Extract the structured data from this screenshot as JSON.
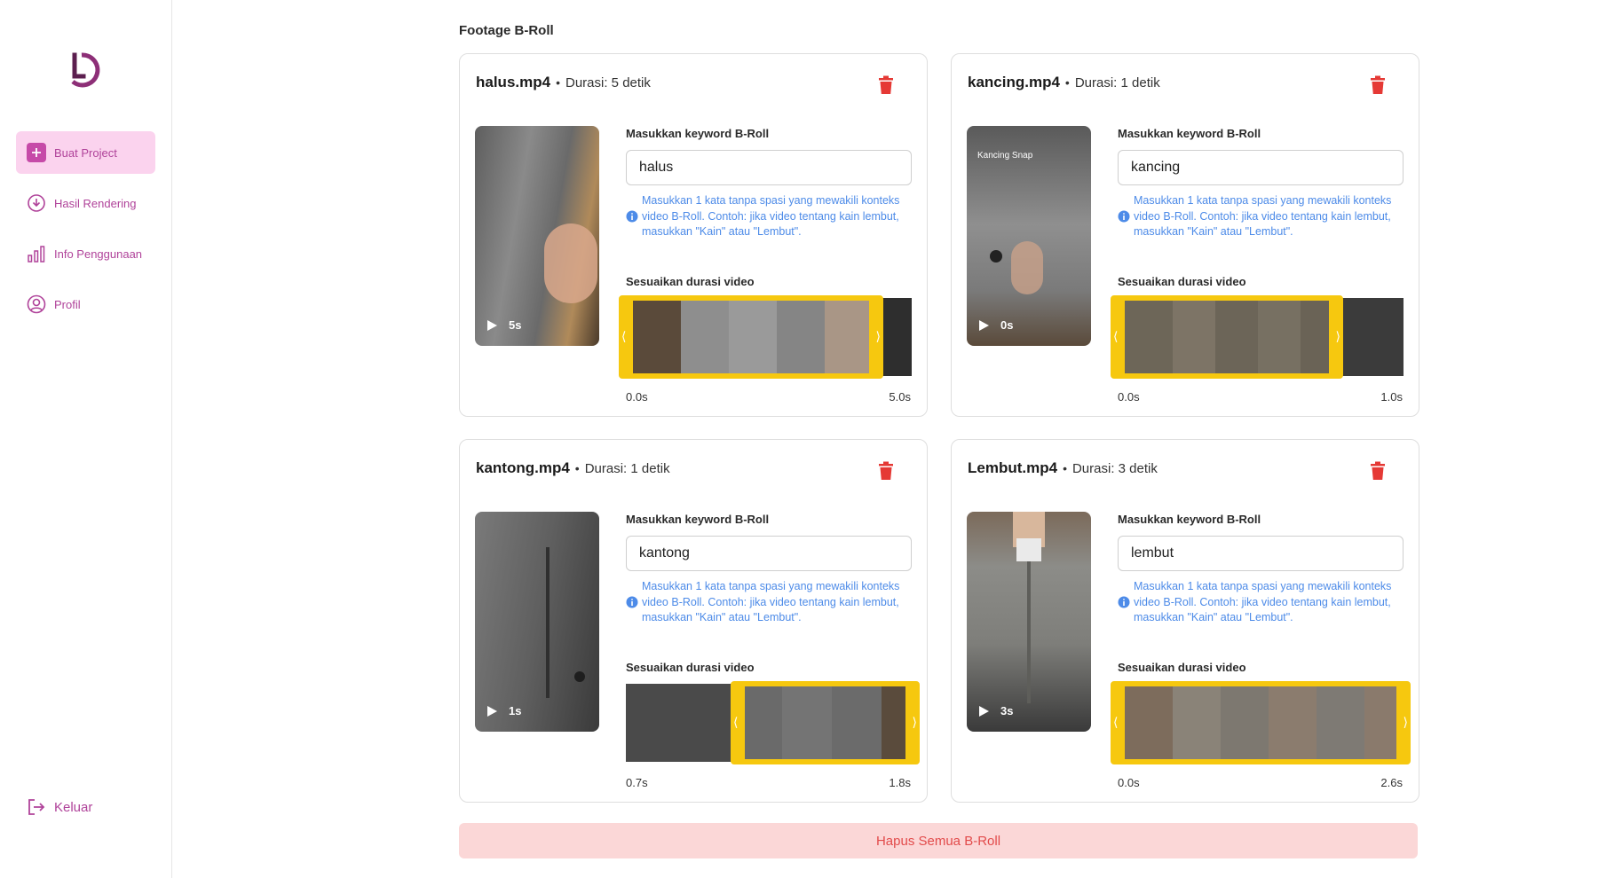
{
  "sidebar": {
    "items": [
      {
        "label": "Buat Project"
      },
      {
        "label": "Hasil Rendering"
      },
      {
        "label": "Info Penggunaan"
      },
      {
        "label": "Profil"
      }
    ],
    "logout_label": "Keluar"
  },
  "main": {
    "section_title": "Footage B-Roll",
    "delete_all_label": "Hapus Semua B-Roll",
    "cards": [
      {
        "filename": "halus.mp4",
        "duration_text": "Durasi: 5 detik",
        "thumb_time": "5s",
        "thumb_caption": "",
        "keyword_label": "Masukkan keyword B-Roll",
        "keyword_value": "halus",
        "hint": "Masukkan 1 kata tanpa spasi yang mewakili konteks video B-Roll. Contoh: jika video tentang kain lembut, masukkan \"Kain\" atau \"Lembut\".",
        "duration_label": "Sesuaikan durasi video",
        "start_time": "0.0s",
        "end_time": "5.0s"
      },
      {
        "filename": "kancing.mp4",
        "duration_text": "Durasi: 1 detik",
        "thumb_time": "0s",
        "thumb_caption": "Kancing Snap",
        "keyword_label": "Masukkan keyword B-Roll",
        "keyword_value": "kancing",
        "hint": "Masukkan 1 kata tanpa spasi yang mewakili konteks video B-Roll. Contoh: jika video tentang kain lembut, masukkan \"Kain\" atau \"Lembut\".",
        "duration_label": "Sesuaikan durasi video",
        "start_time": "0.0s",
        "end_time": "1.0s"
      },
      {
        "filename": "kantong.mp4",
        "duration_text": "Durasi: 1 detik",
        "thumb_time": "1s",
        "thumb_caption": "",
        "keyword_label": "Masukkan keyword B-Roll",
        "keyword_value": "kantong",
        "hint": "Masukkan 1 kata tanpa spasi yang mewakili konteks video B-Roll. Contoh: jika video tentang kain lembut, masukkan \"Kain\" atau \"Lembut\".",
        "duration_label": "Sesuaikan durasi video",
        "start_time": "0.7s",
        "end_time": "1.8s"
      },
      {
        "filename": "Lembut.mp4",
        "duration_text": "Durasi: 3 detik",
        "thumb_time": "3s",
        "thumb_caption": "",
        "keyword_label": "Masukkan keyword B-Roll",
        "keyword_value": "lembut",
        "hint": "Masukkan 1 kata tanpa spasi yang mewakili konteks video B-Roll. Contoh: jika video tentang kain lembut, masukkan \"Kain\" atau \"Lembut\".",
        "duration_label": "Sesuaikan durasi video",
        "start_time": "0.0s",
        "end_time": "2.6s"
      }
    ]
  },
  "colors": {
    "accent": "#b0439a",
    "active_bg": "#fbd3ee",
    "selection": "#f6c80f",
    "hint": "#4d8be8",
    "danger": "#e24b4b",
    "danger_bg": "#fbd7d7"
  }
}
